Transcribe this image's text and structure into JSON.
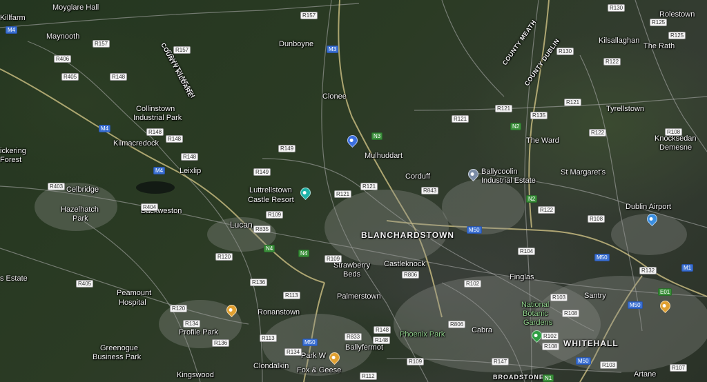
{
  "places": [
    "Moyglare Hall",
    "Killfarm",
    "Maynooth",
    "Dunboyne",
    "Clonee",
    "Collinstown",
    "Industrial Park",
    "Kilmacredock",
    "ickering",
    "Forest",
    "Leixlip",
    "Celbridge",
    "Hazelhatch",
    "Park",
    "Backweston",
    "Luttrellstown",
    "Castle Resort",
    "Lucan",
    "Mulhuddart",
    "Corduff",
    "BLANCHARDSTOWN",
    "Strawberry",
    "Beds",
    "Castleknock",
    "s Estate",
    "Palmerstown",
    "Peamount",
    "Hospital",
    "Ronanstown",
    "Profile Park",
    "Greenogue",
    "Business Park",
    "Clondalkin",
    "Kingswood",
    "Park W",
    "Fox & Geese",
    "Ballyfermot",
    "Phoenix Park",
    "Cabra",
    "Finglas",
    "National",
    "Botanic",
    "Gardens",
    "WHITEHALL",
    "Santry",
    "Artane",
    "BROADSTONE",
    "Ballycoolin",
    "Industrial Estate",
    "The Ward",
    "St Margaret's",
    "Tyrellstown",
    "Kilsallaghan",
    "The Rath",
    "Rolestown",
    "Knocksedan",
    "Demesne",
    "Dublin Airport"
  ],
  "counties": [
    "COUNTY MEATH",
    "COUNTY KILDARE",
    "COUNTY MEATH",
    "COUNTY DUBLIN"
  ],
  "roads": [
    "M4",
    "R157",
    "R406",
    "R405",
    "R148",
    "R157",
    "R157",
    "M3",
    "M4",
    "R148",
    "R148",
    "R148",
    "M4",
    "R149",
    "R149",
    "R403",
    "R404",
    "R109",
    "R835",
    "N4",
    "N4",
    "R120",
    "R109",
    "R136",
    "R405",
    "R113",
    "R120",
    "R134",
    "R136",
    "R113",
    "M50",
    "R134",
    "R833",
    "R148",
    "R148",
    "R112",
    "R109",
    "R121",
    "R121",
    "N3",
    "R843",
    "R121",
    "R121",
    "M50",
    "R806",
    "R102",
    "R806",
    "R147",
    "R104",
    "N2",
    "R135",
    "R121",
    "R122",
    "R122",
    "R130",
    "R125",
    "R125",
    "R130",
    "R108",
    "N2",
    "R122",
    "R108",
    "M50",
    "R132",
    "M1",
    "E01",
    "M50",
    "R103",
    "R108",
    "R102",
    "R108",
    "M50",
    "R103",
    "R107",
    "N1"
  ]
}
